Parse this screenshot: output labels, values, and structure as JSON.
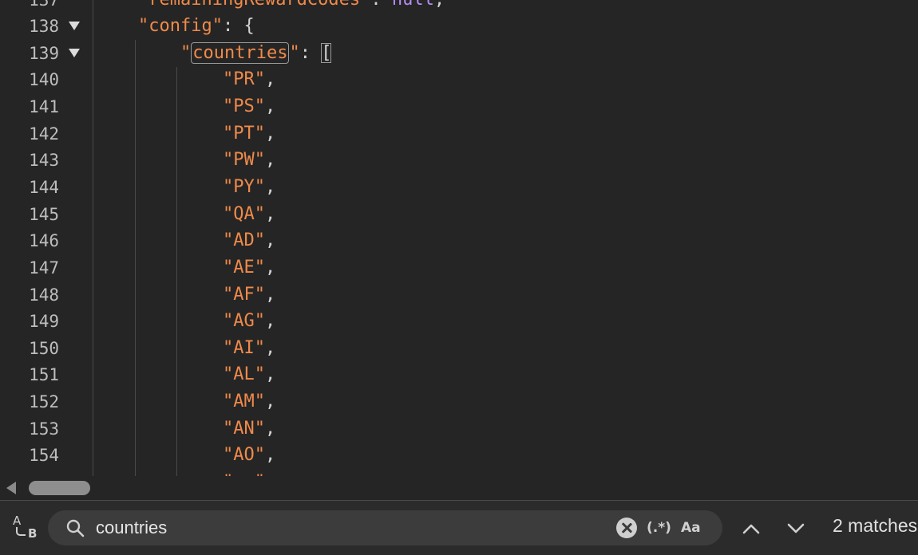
{
  "editor": {
    "top_partial": {
      "key": "remainingRewardCodes",
      "value": "null"
    },
    "lines": [
      {
        "num": "138",
        "fold": true,
        "kind": "config",
        "key": "config"
      },
      {
        "num": "139",
        "fold": true,
        "kind": "countries",
        "key": "countries"
      },
      {
        "num": "140",
        "kind": "item",
        "value": "PR"
      },
      {
        "num": "141",
        "kind": "item",
        "value": "PS"
      },
      {
        "num": "142",
        "kind": "item",
        "value": "PT"
      },
      {
        "num": "143",
        "kind": "item",
        "value": "PW"
      },
      {
        "num": "144",
        "kind": "item",
        "value": "PY"
      },
      {
        "num": "145",
        "kind": "item",
        "value": "QA"
      },
      {
        "num": "146",
        "kind": "item",
        "value": "AD"
      },
      {
        "num": "147",
        "kind": "item",
        "value": "AE"
      },
      {
        "num": "148",
        "kind": "item",
        "value": "AF"
      },
      {
        "num": "149",
        "kind": "item",
        "value": "AG"
      },
      {
        "num": "150",
        "kind": "item",
        "value": "AI"
      },
      {
        "num": "151",
        "kind": "item",
        "value": "AL"
      },
      {
        "num": "152",
        "kind": "item",
        "value": "AM"
      },
      {
        "num": "153",
        "kind": "item",
        "value": "AN"
      },
      {
        "num": "154",
        "kind": "item",
        "value": "AO"
      }
    ],
    "top_partial_num": "137"
  },
  "search": {
    "query": "countries",
    "regex_label": "(.*)",
    "case_label": "Aa",
    "match_count": "2 matches"
  },
  "colors": {
    "background": "#252525",
    "string": "#f08a4b",
    "keyword_value": "#b68ef2",
    "line_number": "#bdbdbd"
  },
  "icons": [
    "replace-toggle-icon",
    "search-icon",
    "clear-icon",
    "chevron-up-icon",
    "chevron-down-icon",
    "fold-arrow-icon"
  ]
}
